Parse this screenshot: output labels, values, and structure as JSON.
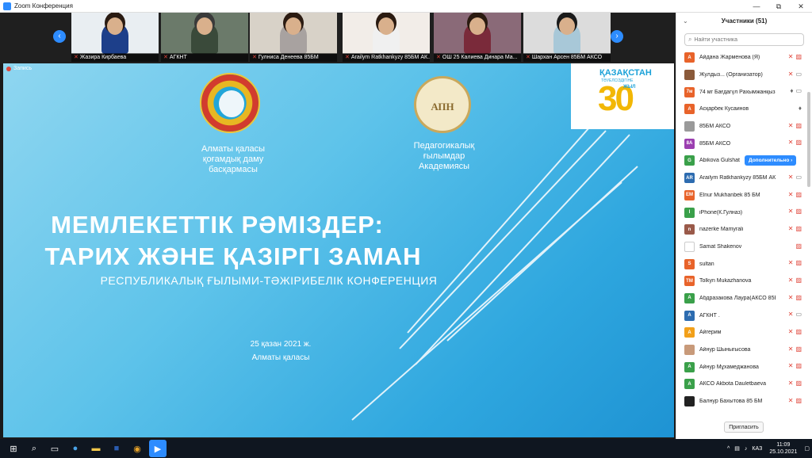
{
  "window": {
    "title": "Zoom Конференция",
    "controls": [
      "—",
      "⧉",
      "✕"
    ]
  },
  "video_tiles": [
    {
      "name": "Жазира Кирбаева",
      "bg": "#e9eef2",
      "shirt": "#1d3f8a",
      "hair": "#2a1b12"
    },
    {
      "name": "АГКНТ",
      "bg": "#6b7a6a",
      "shirt": "#3a4a3a",
      "hair": "#3a3a3a"
    },
    {
      "name": "Гулнисa Денеева 85БМ",
      "bg": "#d8d2c8",
      "shirt": "#a8a2a0",
      "hair": "#2b1b12"
    },
    {
      "name": "Arailym Ratkhankyzy 85БМ АК...",
      "bg": "#f2ede8",
      "shirt": "#f0f0f0",
      "hair": "#2a1a10"
    },
    {
      "name": "ОШ 25 Калиева Динара Ма...",
      "bg": "#8a6a78",
      "shirt": "#7a2a3a",
      "hair": "#2a1a10"
    },
    {
      "name": "Шархан Арсен 85БМ АКСО",
      "bg": "#dcdcdc",
      "shirt": "#a8c8d8",
      "hair": "#1a1a1a"
    }
  ],
  "recording_label": "Запись",
  "slide": {
    "org1": "Алматы қаласы\nқоғамдық даму\nбасқармасы",
    "org2": "Педагогикалық\nғылымдар\nАкадемиясы",
    "emblem2_text": "АПН",
    "logo_country": "ҚАЗАҚСТАН",
    "logo_sub": "ТӘУЕЛСІЗДІГІНЕ",
    "logo_num": "30",
    "logo_jyl": "ЖЫЛ",
    "title_line1": "МЕМЛЕКЕТТІК РӘМІЗДЕР:",
    "title_line2": "ТАРИХ ЖӘНЕ ҚАЗІРГІ ЗАМАН",
    "subtitle": "РЕСПУБЛИКАЛЫҚ ҒЫЛЫМИ-ТӘЖІРИБЕЛІК КОНФЕРЕНЦИЯ",
    "date": "25 қазан 2021 ж.",
    "city": "Алматы қаласы"
  },
  "panel": {
    "title": "Участники (51)",
    "search_placeholder": "Найти участника",
    "more_button": "Дополнительно ›",
    "invite": "Пригласить",
    "participants": [
      {
        "initials": "А",
        "color": "#e8632a",
        "name": "Айдана Жарменова (Я)",
        "mic": "off",
        "cam": "off"
      },
      {
        "initials": "",
        "color": "#8a5a3a",
        "name": "Жулдыз... (Организатор)",
        "mic": "off",
        "cam": "on"
      },
      {
        "initials": "7м",
        "color": "#e8632a",
        "name": "74 мг Бағдагүл Рахымжанқызы",
        "mic": "on",
        "cam": "on"
      },
      {
        "initials": "А",
        "color": "#e8632a",
        "name": "Асқарбек Кусаинов",
        "mic": "on",
        "cam": "none"
      },
      {
        "initials": "",
        "color": "#9a9a9a",
        "name": "85БМ АКСО",
        "mic": "off",
        "cam": "off"
      },
      {
        "initials": "8А",
        "color": "#9b3fb0",
        "name": "85БМ АКСО",
        "mic": "off",
        "cam": "off"
      },
      {
        "initials": "G",
        "color": "#3aa04a",
        "name": "Abikova Gulshat",
        "mic": "none",
        "cam": "none"
      },
      {
        "initials": "AR",
        "color": "#2d6cb0",
        "name": "Arailym Ratkhankyzy 85БМ АКСО",
        "mic": "off",
        "cam": "on"
      },
      {
        "initials": "EM",
        "color": "#e8632a",
        "name": "Elnur Mukhanbek 85 БМ",
        "mic": "off",
        "cam": "off"
      },
      {
        "initials": "I",
        "color": "#3aa04a",
        "name": "iPhone(К.Гулназ)",
        "mic": "off",
        "cam": "off"
      },
      {
        "initials": "n",
        "color": "#9a5a4a",
        "name": "nazerke Mamyrali",
        "mic": "off",
        "cam": "off"
      },
      {
        "initials": "",
        "color": "#ffffff",
        "name": "Samat Shakenov",
        "mic": "none",
        "cam": "off"
      },
      {
        "initials": "S",
        "color": "#e8632a",
        "name": "sultan",
        "mic": "off",
        "cam": "off"
      },
      {
        "initials": "TM",
        "color": "#e8632a",
        "name": "Tolkyn Mukazhanova",
        "mic": "off",
        "cam": "off"
      },
      {
        "initials": "А",
        "color": "#3aa04a",
        "name": "Абдразакова Лаура(АКСО 85Б...",
        "mic": "off",
        "cam": "off"
      },
      {
        "initials": "А",
        "color": "#2d6cb0",
        "name": "АГКНТ .",
        "mic": "off",
        "cam": "on"
      },
      {
        "initials": "А",
        "color": "#f2a01a",
        "name": "Айгерим",
        "mic": "off",
        "cam": "off"
      },
      {
        "initials": "",
        "color": "#c89a7a",
        "name": "Айнур Шыныrысова",
        "mic": "off",
        "cam": "off"
      },
      {
        "initials": "А",
        "color": "#3aa04a",
        "name": "Айнур Мұхамеджанова",
        "mic": "off",
        "cam": "off"
      },
      {
        "initials": "А",
        "color": "#3aa04a",
        "name": "АКСО Akbota Dauletbaeva",
        "mic": "off",
        "cam": "off"
      },
      {
        "initials": "",
        "color": "#222222",
        "name": "Балнур Бахытова 85 БМ",
        "mic": "off",
        "cam": "off"
      }
    ]
  },
  "taskbar": {
    "lang": "КАЗ",
    "time": "11:09",
    "date": "25.10.2021"
  }
}
